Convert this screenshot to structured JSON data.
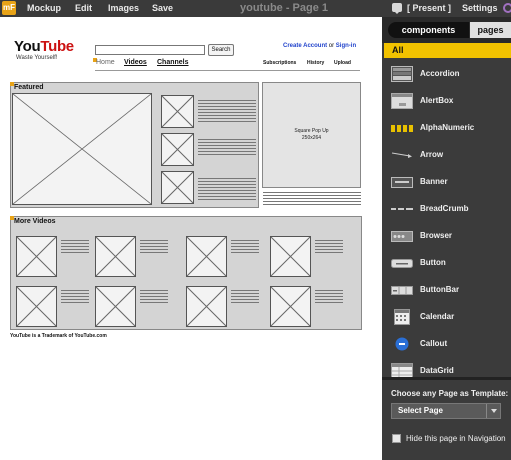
{
  "app": {
    "logo": "mF",
    "menu": [
      "Mockup",
      "Edit",
      "Images",
      "Save"
    ],
    "title": "youtube - Page 1",
    "present_label": "[ Present ]",
    "settings_label": "Settings"
  },
  "mockup": {
    "logo_you": "You",
    "logo_tube": "Tube",
    "tagline": "Waste Yourself!",
    "search_button": "Search",
    "account_link": "Create Account",
    "account_or": " or ",
    "signin_link": "Sign-in",
    "nav": [
      "Home",
      "Videos",
      "Channels"
    ],
    "sub_links": [
      "Subscriptions",
      "History",
      "Upload"
    ],
    "featured_title": "Featured",
    "popup_line1": "Square Pop Up",
    "popup_line2": "250x264",
    "more_videos_title": "More Videos",
    "footer": "YouTube is a Trademark of YouTube.com"
  },
  "sidebar": {
    "tab_components": "components",
    "tab_pages": "pages",
    "filter_all": "All",
    "components": [
      {
        "label": "Accordion",
        "icon": "accordion-icon"
      },
      {
        "label": "AlertBox",
        "icon": "alertbox-icon"
      },
      {
        "label": "AlphaNumeric",
        "icon": "alphanumeric-icon"
      },
      {
        "label": "Arrow",
        "icon": "arrow-icon"
      },
      {
        "label": "Banner",
        "icon": "banner-icon"
      },
      {
        "label": "BreadCrumb",
        "icon": "breadcrumb-icon"
      },
      {
        "label": "Browser",
        "icon": "browser-icon"
      },
      {
        "label": "Button",
        "icon": "button-icon"
      },
      {
        "label": "ButtonBar",
        "icon": "buttonbar-icon"
      },
      {
        "label": "Calendar",
        "icon": "calendar-icon"
      },
      {
        "label": "Callout",
        "icon": "callout-icon"
      },
      {
        "label": "DataGrid",
        "icon": "datagrid-icon"
      }
    ],
    "template_label": "Choose any Page as Template:",
    "template_select": "Select Page",
    "hide_label": "Hide this page in Navigation"
  }
}
